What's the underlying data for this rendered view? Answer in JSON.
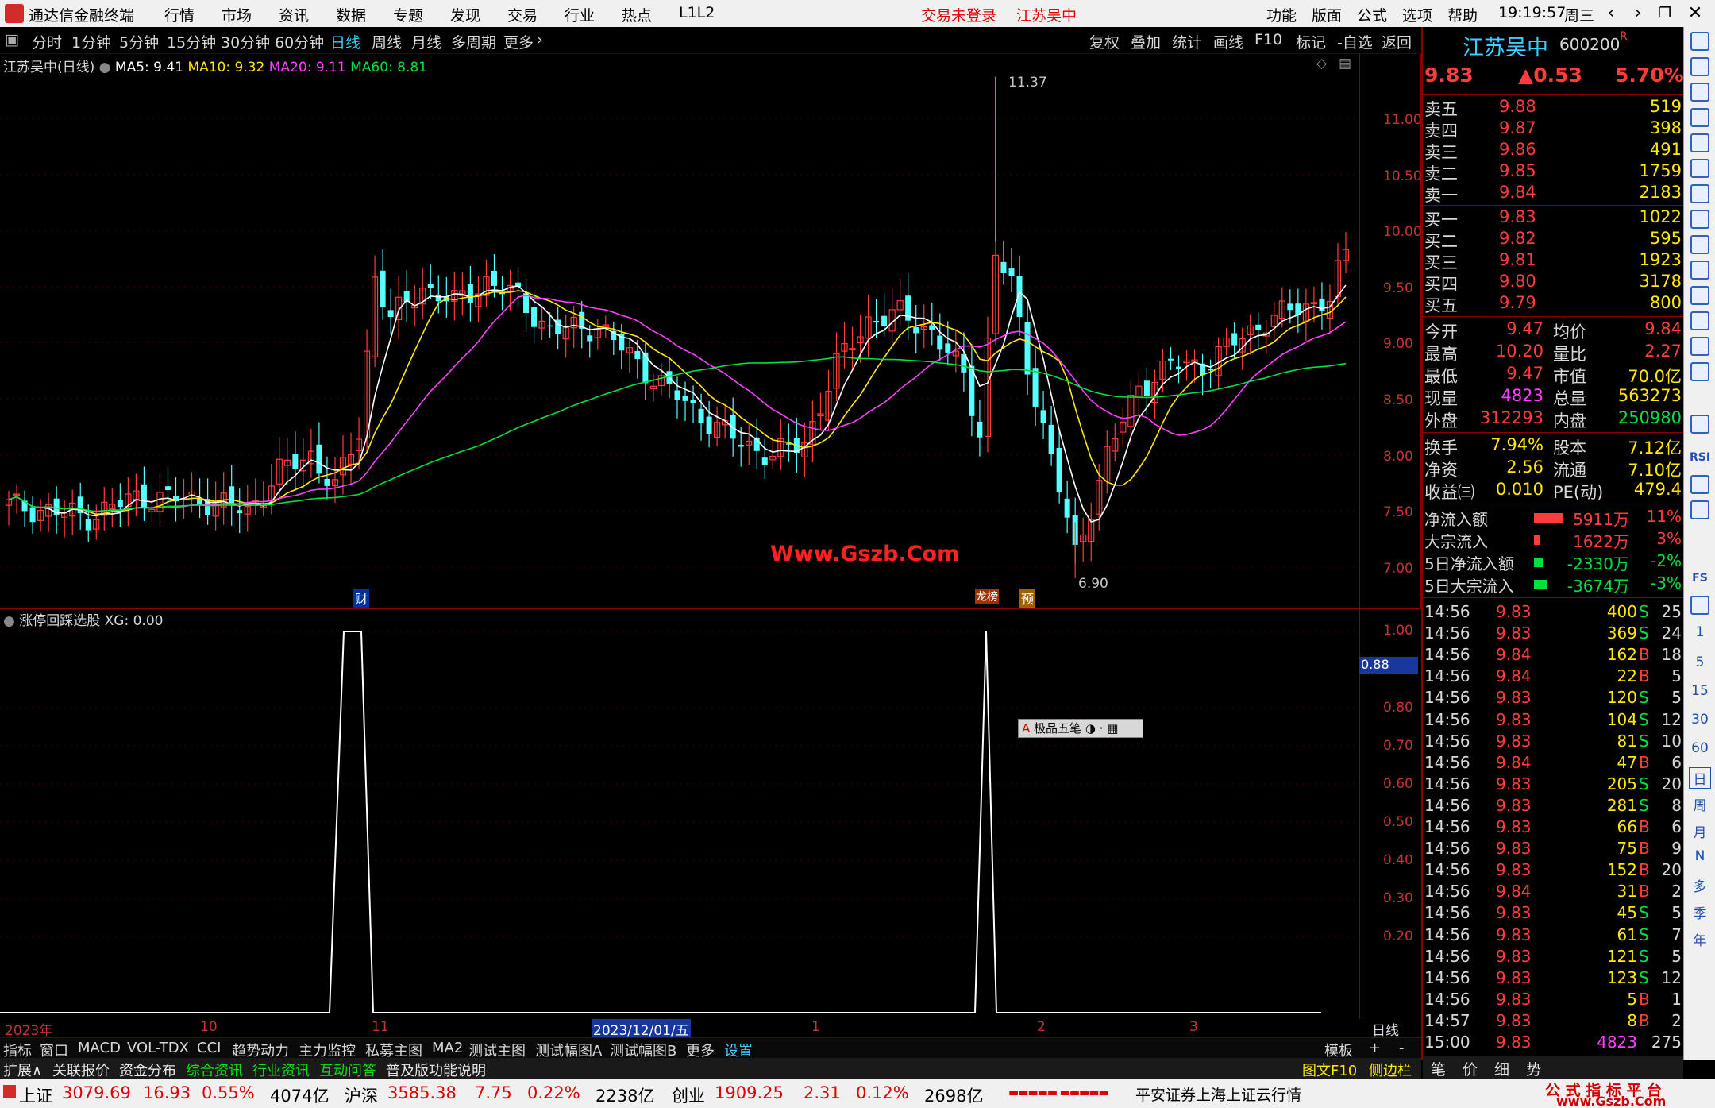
{
  "titlebar": {
    "app_title": "通达信金融终端",
    "menus": [
      "行情",
      "市场",
      "资讯",
      "数据",
      "专题",
      "发现",
      "交易",
      "行业",
      "热点",
      "L1L2"
    ],
    "notice_login": "交易未登录",
    "notice_stock": "江苏吴中",
    "right_menus": [
      "功能",
      "版面",
      "公式",
      "选项",
      "帮助"
    ],
    "time": "19:19:57",
    "weekday": "周三"
  },
  "toolbar": {
    "periods": [
      "分时",
      "1分钟",
      "5分钟",
      "15分钟",
      "30分钟",
      "60分钟",
      "日线",
      "周线",
      "月线",
      "多周期",
      "更多"
    ],
    "active_period": "日线",
    "right_buttons": [
      "复权",
      "叠加",
      "统计",
      "画线",
      "F10",
      "标记",
      "-自选",
      "返回"
    ]
  },
  "main_chart": {
    "legend_name": "江苏吴中(日线)",
    "ma5": "MA5: 9.41",
    "ma10": "MA10: 9.32",
    "ma20": "MA20: 9.11",
    "ma60": "MA60: 8.81",
    "y_ticks": [
      "11.00",
      "10.50",
      "10.00",
      "9.50",
      "9.00",
      "8.50",
      "8.00",
      "7.50",
      "7.00"
    ],
    "high_label": "11.37",
    "low_label": "6.90",
    "marker_cai": "财",
    "marker_long": "龙榜",
    "marker_yu": "预",
    "watermark": "Www.Gszb.Com"
  },
  "colors": {
    "up": "#ff3c3c",
    "down": "#54ffff",
    "ma5": "#ffffff",
    "ma10": "#ffe800",
    "ma20": "#ff40ff",
    "ma60": "#00e040"
  },
  "chart_data": {
    "type": "line",
    "title": "江苏吴中(日线)",
    "y_range": [
      6.8,
      11.4
    ],
    "price_ticks": [
      11.0,
      10.5,
      10.0,
      9.5,
      9.0,
      8.5,
      8.0,
      7.5,
      7.0
    ],
    "indicator_ticks": [
      1.0,
      0.8,
      0.7,
      0.6,
      0.5,
      0.4,
      0.3,
      0.2
    ],
    "series": [
      {
        "name": "MA5",
        "last": 9.41
      },
      {
        "name": "MA10",
        "last": 9.32
      },
      {
        "name": "MA20",
        "last": 9.11
      },
      {
        "name": "MA60",
        "last": 8.81
      },
      {
        "name": "XG",
        "last": 0.0
      }
    ],
    "high": 11.37,
    "low": 6.9,
    "xg_peaks": 2
  },
  "sub_chart": {
    "legend_name": "涨停回踩选股",
    "xg": "XG: 0.00",
    "y_ticks": [
      "1.00",
      "0.80",
      "0.70",
      "0.60",
      "0.50",
      "0.40",
      "0.30",
      "0.20"
    ],
    "cursor_value": "0.88",
    "ime_label": "极品五笔"
  },
  "time_axis": {
    "labels": [
      "2023年",
      "10",
      "11",
      "2023/12/01/五",
      "1",
      "2",
      "3"
    ],
    "right_label": "日线"
  },
  "stock": {
    "name": "江苏吴中",
    "code": "600200",
    "flag": "R",
    "price": "9.83",
    "change": "▲0.53",
    "pct": "5.70%"
  },
  "order_book": {
    "asks": [
      {
        "l": "卖五",
        "p": "9.88",
        "v": "519"
      },
      {
        "l": "卖四",
        "p": "9.87",
        "v": "398"
      },
      {
        "l": "卖三",
        "p": "9.86",
        "v": "491"
      },
      {
        "l": "卖二",
        "p": "9.85",
        "v": "1759"
      },
      {
        "l": "卖一",
        "p": "9.84",
        "v": "2183"
      }
    ],
    "bids": [
      {
        "l": "买一",
        "p": "9.83",
        "v": "1022"
      },
      {
        "l": "买二",
        "p": "9.82",
        "v": "595"
      },
      {
        "l": "买三",
        "p": "9.81",
        "v": "1923"
      },
      {
        "l": "买四",
        "p": "9.80",
        "v": "3178"
      },
      {
        "l": "买五",
        "p": "9.79",
        "v": "800"
      }
    ]
  },
  "quote": [
    {
      "a": "今开",
      "av": "9.47",
      "b": "均价",
      "bv": "9.84"
    },
    {
      "a": "最高",
      "av": "10.20",
      "b": "量比",
      "bv": "2.27"
    },
    {
      "a": "最低",
      "av": "9.47",
      "b": "市值",
      "bv": "70.0亿"
    },
    {
      "a": "现量",
      "av": "4823",
      "b": "总量",
      "bv": "563273"
    },
    {
      "a": "外盘",
      "av": "312293",
      "b": "内盘",
      "bv": "250980"
    }
  ],
  "fund": [
    {
      "a": "换手",
      "av": "7.94%",
      "b": "股本",
      "bv": "7.12亿"
    },
    {
      "a": "净资",
      "av": "2.56",
      "b": "流通",
      "bv": "7.10亿"
    },
    {
      "a": "收益㈢",
      "av": "0.010",
      "b": "PE(动)",
      "bv": "479.4"
    }
  ],
  "flows": [
    {
      "l": "净流入额",
      "v": "5911万",
      "p": "11%"
    },
    {
      "l": "大宗流入",
      "v": "1622万",
      "p": "3%"
    },
    {
      "l": "5日净流入额",
      "v": "-2330万",
      "p": "-2%"
    },
    {
      "l": "5日大宗流入",
      "v": "-3674万",
      "p": "-3%"
    }
  ],
  "ticks": [
    [
      "14:56",
      "9.83",
      "400",
      "S",
      "25"
    ],
    [
      "14:56",
      "9.83",
      "369",
      "S",
      "24"
    ],
    [
      "14:56",
      "9.84",
      "162",
      "B",
      "18"
    ],
    [
      "14:56",
      "9.84",
      "22",
      "B",
      "5"
    ],
    [
      "14:56",
      "9.83",
      "120",
      "S",
      "5"
    ],
    [
      "14:56",
      "9.83",
      "104",
      "S",
      "12"
    ],
    [
      "14:56",
      "9.83",
      "81",
      "S",
      "10"
    ],
    [
      "14:56",
      "9.84",
      "47",
      "B",
      "6"
    ],
    [
      "14:56",
      "9.83",
      "205",
      "S",
      "20"
    ],
    [
      "14:56",
      "9.83",
      "281",
      "S",
      "8"
    ],
    [
      "14:56",
      "9.83",
      "66",
      "B",
      "6"
    ],
    [
      "14:56",
      "9.83",
      "75",
      "B",
      "9"
    ],
    [
      "14:56",
      "9.83",
      "152",
      "B",
      "20"
    ],
    [
      "14:56",
      "9.84",
      "31",
      "B",
      "2"
    ],
    [
      "14:56",
      "9.83",
      "45",
      "S",
      "5"
    ],
    [
      "14:56",
      "9.83",
      "61",
      "S",
      "7"
    ],
    [
      "14:56",
      "9.83",
      "121",
      "S",
      "5"
    ],
    [
      "14:56",
      "9.83",
      "123",
      "S",
      "12"
    ],
    [
      "14:56",
      "9.83",
      "5",
      "B",
      "1"
    ],
    [
      "14:57",
      "9.83",
      "8",
      "B",
      "2"
    ],
    [
      "15:00",
      "9.83",
      "4823",
      "",
      "275"
    ]
  ],
  "tabs1": [
    "指标",
    "窗口",
    "MACD",
    "VOL-TDX",
    "CCI",
    "趋势动力",
    "主力监控",
    "私募主图",
    "MA2",
    "测试主图",
    "测试幅图A",
    "测试幅图B",
    "更多",
    "设置"
  ],
  "tabs1_right": [
    "模板",
    "+",
    "-"
  ],
  "tabs2": [
    "扩展∧",
    "关联报价",
    "资金分布",
    "综合资讯",
    "行业资讯",
    "互动问答",
    "普及版功能说明"
  ],
  "tabs2_right": [
    "图文F10",
    "侧边栏《",
    "笔",
    "价",
    "细",
    "势"
  ],
  "side_labels": [
    "RSI",
    "FS",
    "1",
    "5",
    "15",
    "30",
    "60",
    "日",
    "周",
    "月",
    "N",
    "多",
    "季",
    "年"
  ],
  "status": {
    "sh_name": "上证",
    "sh_val": "3079.69",
    "sh_chg": "16.93",
    "sh_pct": "0.55%",
    "sh_amt": "4074亿",
    "sz_name": "沪深",
    "sz_val": "3585.38",
    "sz_chg": "7.75",
    "sz_pct": "0.22%",
    "sz_amt": "2238亿",
    "cy_name": "创业",
    "cy_val": "1909.25",
    "cy_chg": "2.31",
    "cy_pct": "0.12%",
    "cy_amt": "2698亿",
    "broker": "平安证券上海上证云行情",
    "brand1": "公 式 指 标 平 台",
    "brand2": "www.Gszb.Com"
  }
}
